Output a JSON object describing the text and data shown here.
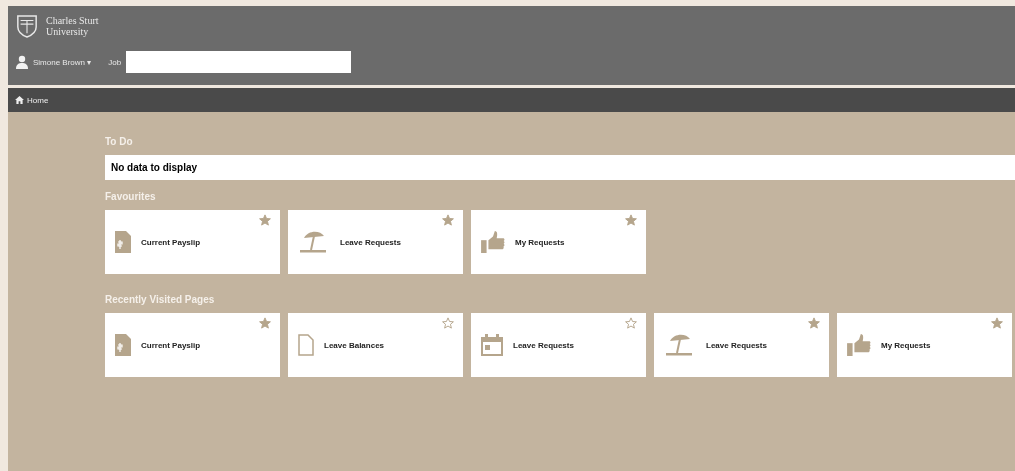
{
  "header": {
    "logo_line_1": "Charles Sturt",
    "logo_line_2": "University",
    "user": "Simone Brown ▾",
    "job_label": "Job"
  },
  "nav": {
    "home": "Home"
  },
  "todo": {
    "title": "To Do",
    "message": "No data to display"
  },
  "favourites": {
    "title": "Favourites",
    "tiles": [
      {
        "label": "Current Payslip",
        "kind": "payslip",
        "starred": true
      },
      {
        "label": "Leave Requests",
        "kind": "umbrella",
        "starred": true
      },
      {
        "label": "My Requests",
        "kind": "thumbs",
        "starred": true
      }
    ]
  },
  "recent": {
    "title": "Recently Visited Pages",
    "tiles": [
      {
        "label": "Current Payslip",
        "kind": "payslip",
        "starred": true
      },
      {
        "label": "Leave Balances",
        "kind": "document",
        "starred": false
      },
      {
        "label": "Leave Requests",
        "kind": "calendar",
        "starred": false
      },
      {
        "label": "Leave Requests",
        "kind": "umbrella",
        "starred": true
      },
      {
        "label": "My Requests",
        "kind": "thumbs",
        "starred": true
      }
    ]
  }
}
